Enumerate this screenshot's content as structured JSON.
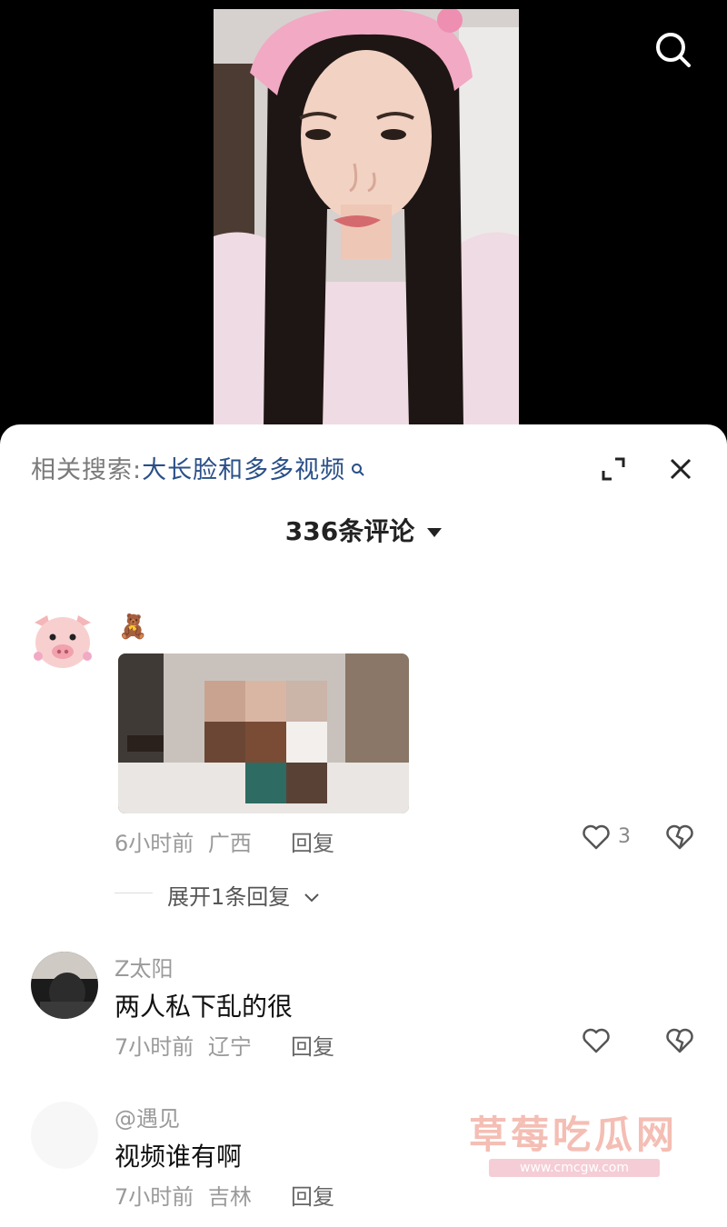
{
  "related_search": {
    "prefix": "相关搜索:",
    "query": "大长脸和多多视频"
  },
  "comments_header": {
    "count_label": "336条评论"
  },
  "comments": [
    {
      "name": "",
      "emoji": "🧸",
      "text": "",
      "time": "6小时前",
      "location": "广西",
      "reply_label": "回复",
      "likes": "3",
      "expand_label": "展开1条回复"
    },
    {
      "name": "Z太阳",
      "text": "两人私下乱的很",
      "time": "7小时前",
      "location": "辽宁",
      "reply_label": "回复",
      "likes": ""
    },
    {
      "name": "@遇见",
      "text": "视频谁有啊",
      "time": "7小时前",
      "location": "吉林",
      "reply_label": "回复",
      "likes": ""
    }
  ],
  "watermark": {
    "title": "草莓吃瓜网",
    "url": "www.cmcgw.com"
  },
  "colors": {
    "link": "#2a4f88",
    "watermark": "#f3b3a8"
  }
}
